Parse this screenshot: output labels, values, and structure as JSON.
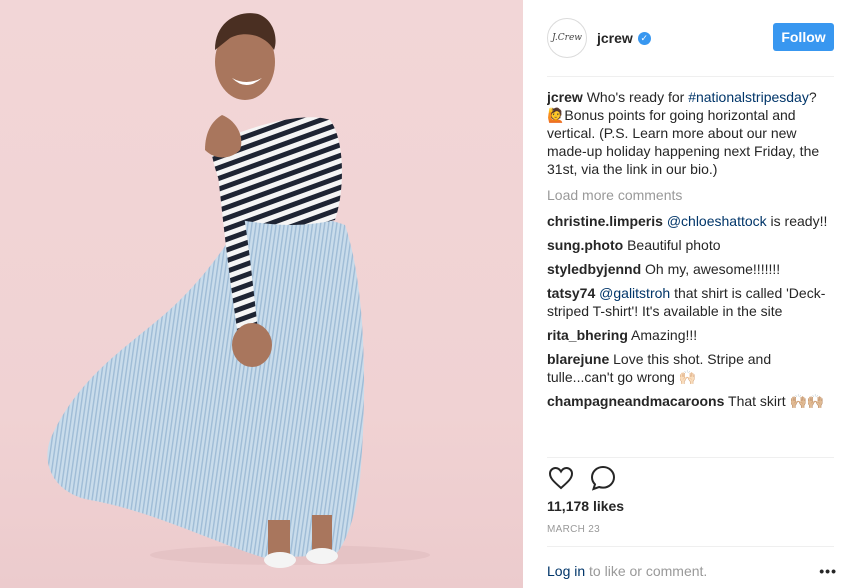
{
  "post": {
    "username": "jcrew",
    "avatar_text": "J.Crew",
    "verified_icon": "verified-badge-icon",
    "follow_label": "Follow",
    "caption": {
      "username": "jcrew",
      "text_before": "Who's ready for ",
      "hashtag": "#nationalstripesday",
      "text_after": "? 🙋Bonus points for going horizontal and vertical. (P.S. Learn more about our new made-up holiday happening next Friday, the 31st, via the link in our bio.)"
    },
    "load_more_label": "Load more comments",
    "comments": [
      {
        "user": "christine.limperis",
        "mention": "@chloeshattock",
        "text": " is ready!!"
      },
      {
        "user": "sung.photo",
        "mention": "",
        "text": "Beautiful photo"
      },
      {
        "user": "styledbyjennd",
        "mention": "",
        "text": "Oh my, awesome!!!!!!!"
      },
      {
        "user": "tatsy74",
        "mention": "@galitstroh",
        "text": " that shirt is called 'Deck-striped T-shirt'! It's available in the site"
      },
      {
        "user": "rita_bhering",
        "mention": "",
        "text": "Amazing!!!"
      },
      {
        "user": "blarejune",
        "mention": "",
        "text": "Love this shot. Stripe and tulle...can't go wrong 🙌🏻"
      },
      {
        "user": "champagneandmacaroons",
        "mention": "",
        "text": "That skirt 🙌🏼🙌🏼"
      }
    ],
    "likes": "11,178 likes",
    "date": "MARCH 23",
    "footer": {
      "login_label": "Log in",
      "rest": " to like or comment.",
      "more_label": "•••"
    }
  },
  "colors": {
    "accent": "#3897f0",
    "link": "#003569",
    "muted": "#999999",
    "photo_bg": "#f2d6d7"
  },
  "icons": [
    "heart-icon",
    "comment-icon",
    "more-options-icon"
  ]
}
